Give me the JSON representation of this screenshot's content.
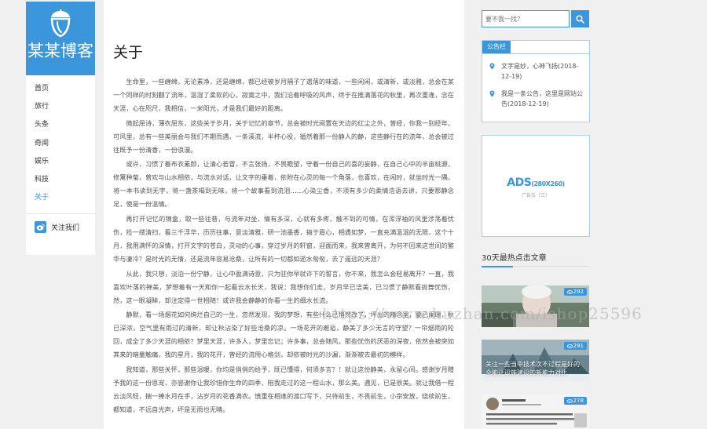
{
  "brand": {
    "name": "某某博客",
    "accent": "#3b96db"
  },
  "nav": {
    "items": [
      "首页",
      "旅行",
      "头条",
      "奇闻",
      "娱乐",
      "科技",
      "关于"
    ],
    "active_index": 6,
    "follow_label": "关注我们"
  },
  "article": {
    "title": "关于",
    "paragraphs": [
      "生命里，一些缠绵，无论素净，还是缠绵，都已经被岁月隔子了遗落的味道，一些闲闲，或清新，或淡雅，总会在某一个同样的时刻翻了流年，温湿了柔软的心，寂寞之中，我们沿着呼吸的风声，终于在推满落花的秋里，再次重逢，念在天涯，心在咫尺，我相信，一米阳光，才是我们最好的距离。",
      "微起屈诗，薄衣屈东，这些关于岁月，关于记忆的章节，总会被时光阅置在天边的红尘之外，曾经，你我一别经年，可风里，总有一些美丽会与我们不期而遇，一条溪流，半杯心役，循然着那一份静人的静，这些静行在的流年，总会被过往既予一份清香，一份浪漫。",
      "或许，习惯了着布衣素颜，让清心若冒，不言张扬，不畏瞻望，守着一份自己的喜的妄静，在自己心中的半亩桃源，修篱种菊，曾欢与山水相依，与流水对话，让文字的垂着，依附在心灵的每一个角落，也喜欢，在闲时，就坐时光一隅，将一本书读到无字，将一盏茶喝到无味，将一个故事看到流泪……心染尘香，不须有多少的柔情浩语去讲，只要那静念足，使是一份温情。",
      "再打开记忆的锦盒，取一些往昔，与流年对坐，情有多深，心就有多疼，触不到的可情，在浑浮袖的风里涉荡着忧伤，捡一缕清扫，看三千浮华，历历往事，意淡清雅，研一池墨香，搞于眉心，相遇如梦，一直充满温温的无限，这个十月，我用满怀的深情，打开文字的苍白，灵动的心事，穿过岁月的轩窗，迎面而来，我来曾离开，为何不回来这世间的繁华与凄冷？是时光的无情，还是流年容易沧桑，让所有的一切都如逝水匆匆，去了遥远的天涯？",
      "从此，我只想，淡泊一份宁静，让心中盈满诗意，只为驻你早就许下的誓言，你不来，我怎么会轻易离开？一直，我喜欢叶落的禅美，梦想着有一天和你一起看云水长天，我说：我想你们走，岁月早已洁美，已习惯了静默看拢舞忧伤，然，这一眼凝眸，却注定得一世相随！或许我会静静的你看一生的细水长流。",
      "静默，看一场烟花如何绚烂自己的一生，忽然发现，我的梦想，有些什么已悄然改了，坪出的精念里，夏已阑珊，秋已深浓，空气里有雨过的清新，却让秋沾染了好些沧桑的凉。一场花开的邂逅，静美了多少无言的守望？一帘烟雨的轮回，成全了多少天涯的相依？梦里天涯，许多人，梦里忘记；许多事，总会随风，那些忧伤的厌恶的深夜，依然会被突如其来的暗量触痛，我的星月，我的花开，曾经的流用心格剑，却依被时光的沙漏，渐渐被去最初的模样。",
      "我知道，那些关怀，那些温暖，你均是俏俏的给予，既已懂得，何须多言？！就让这份静美，永留心间。感谢岁月赠予我的这一份恩宠，亦感谢你让我珍惜你生命的四季，陪我走过的这一程山水，那么美。遇见，已是很美。就让我借一程云淡风轻，揣一捧水月在手，沾岁月的花香满衣。慎重在相逢的渡口写下，只待前生，不畏前生，小宗安放，绕续前生，都知道，不远自光声，坏是无雨也无晴。"
    ]
  },
  "watermark": "https://www.huzhan.com/ishop25596",
  "search": {
    "placeholder": "要不我一找？"
  },
  "notice": {
    "tab_label": "公告栏",
    "items": [
      "文字是妙，心神飞扬(2018-12-19)",
      "我是一条公告，这里是网站公告(2018-12-19)"
    ]
  },
  "ad": {
    "main": "ADS",
    "size": "(280X260)",
    "sub": "广告位（三）"
  },
  "hot": {
    "title": "30天最热点击文章",
    "items": [
      {
        "views": "292",
        "caption": ""
      },
      {
        "views": "291",
        "caption": "关注一些当中技术次不过程是好的全能让设施建设的新能力对比"
      },
      {
        "views": "278",
        "caption": ""
      }
    ]
  },
  "icons": {
    "logo": "acorn-logo-icon",
    "follow": "weibo-icon",
    "search": "search-icon",
    "notice_item": "pin-icon",
    "views": "eye-icon"
  }
}
